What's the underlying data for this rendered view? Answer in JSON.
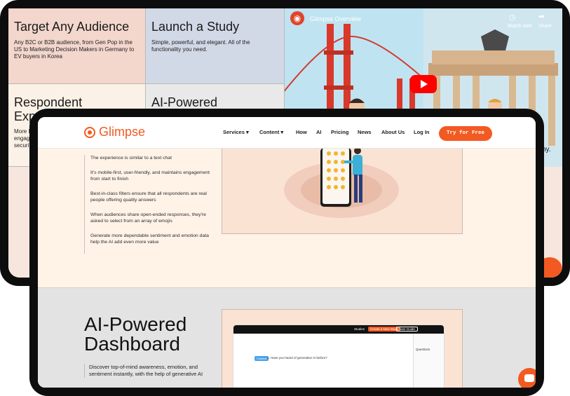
{
  "back": {
    "tiles": [
      {
        "title": "Target Any Audience",
        "text": "Any B2C or B2B audience, from Gen Pop in the US to Marketing Decision Makers in Germany to EV buyers in Korea"
      },
      {
        "title": "Launch a Study",
        "text": "Simple, powerful, and elegant. All of the functionality you need."
      },
      {
        "title": "Respondent Exp",
        "text": "More li engag securit"
      },
      {
        "title": "AI-Powered",
        "text": ""
      }
    ],
    "video": {
      "title": "Glimpse Overview",
      "watch_later": "Watch later",
      "share": "Share",
      "caption_tail": "ny."
    }
  },
  "nav": {
    "brand": "Glimpse",
    "items": [
      "Services",
      "Content",
      "How",
      "AI",
      "Pricing",
      "News",
      "About Us",
      "Log In"
    ],
    "cta": "Try for Free"
  },
  "section1": {
    "bullets": [
      "The experience is similar to a text chat",
      "It's mobile-first, user-friendly, and maintains engagement from start to finish",
      "Best-in-class filters ensure that all respondents are real people offering quality answers",
      "When audiences share open-ended responses, they're asked to select from an array of emojis",
      "Generate more dependable sentiment and emotion data help the AI add even more value"
    ]
  },
  "section2": {
    "title_line1": "AI-Powered",
    "title_line2": "Dashboard",
    "desc": "Discover top-of-mind awareness, emotion, and sentiment instantly, with the help of generative AI",
    "dash": {
      "studies": "Studies",
      "new_study": "Create a New Study",
      "guide": "User Guide",
      "questions": "Questions",
      "question": "1. Have you heard of generative AI before?",
      "tag": "Content"
    }
  },
  "colors": {
    "brand": "#f25a22",
    "peach": "#f3d6cc",
    "slate": "#d2d9e6",
    "cream": "#fff3e8"
  }
}
